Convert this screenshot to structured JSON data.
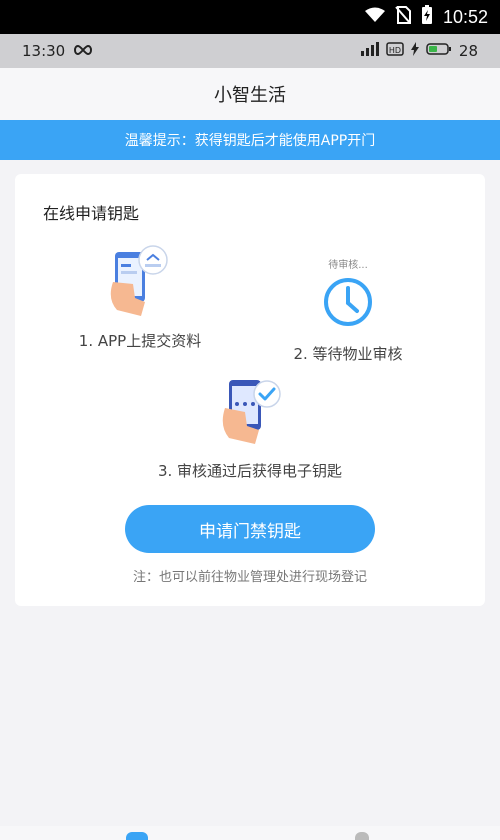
{
  "os_status": {
    "time": "10:52"
  },
  "inner_status": {
    "time": "13:30",
    "battery": "28"
  },
  "header": {
    "title": "小智生活"
  },
  "tip": {
    "text": "温馨提示：获得钥匙后才能使用APP开门"
  },
  "card": {
    "title": "在线申请钥匙",
    "steps": [
      {
        "label": "1. APP上提交资料"
      },
      {
        "label": "2. 等待物业审核",
        "badge": "待审核..."
      },
      {
        "label": "3. 审核通过后获得电子钥匙"
      }
    ],
    "apply_button": "申请门禁钥匙",
    "note": "注：也可以前往物业管理处进行现场登记"
  },
  "colors": {
    "accent": "#3aa4f5",
    "os_bar": "#000000",
    "inner_bar": "#cfcfd2"
  },
  "icons": [
    "wifi-icon",
    "no-sim-icon",
    "battery-charging-icon",
    "infinity-icon",
    "signal-icon",
    "hd-icon",
    "clock-icon",
    "check-icon"
  ]
}
